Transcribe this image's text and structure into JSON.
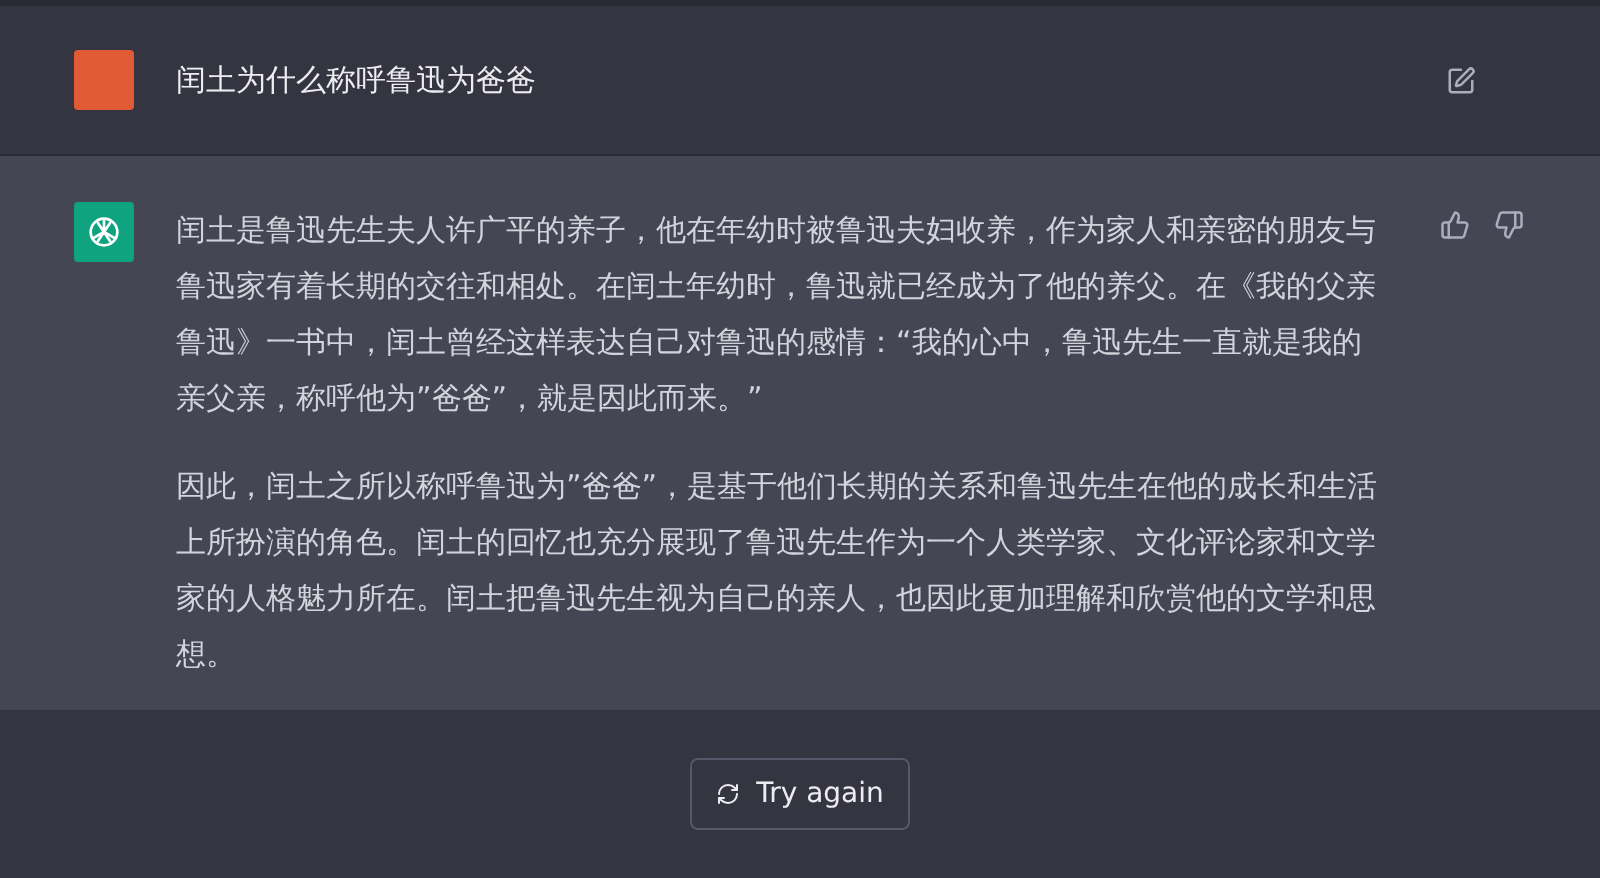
{
  "user_message": {
    "text": "闰土为什么称呼鲁迅为爸爸"
  },
  "assistant_message": {
    "paragraphs": [
      "闰土是鲁迅先生夫人许广平的养子，他在年幼时被鲁迅夫妇收养，作为家人和亲密的朋友与鲁迅家有着长期的交往和相处。在闰土年幼时，鲁迅就已经成为了他的养父。在《我的父亲鲁迅》一书中，闰土曾经这样表达自己对鲁迅的感情：“我的心中，鲁迅先生一直就是我的亲父亲，称呼他为”爸爸”，就是因此而来。”",
      "因此，闰土之所以称呼鲁迅为”爸爸”，是基于他们长期的关系和鲁迅先生在他的成长和生活上所扮演的角色。闰土的回忆也充分展现了鲁迅先生作为一个人类学家、文化评论家和文学家的人格魅力所在。闰土把鲁迅先生视为自己的亲人，也因此更加理解和欣赏他的文学和思想。"
    ]
  },
  "try_again_button": {
    "label": "Try again"
  }
}
